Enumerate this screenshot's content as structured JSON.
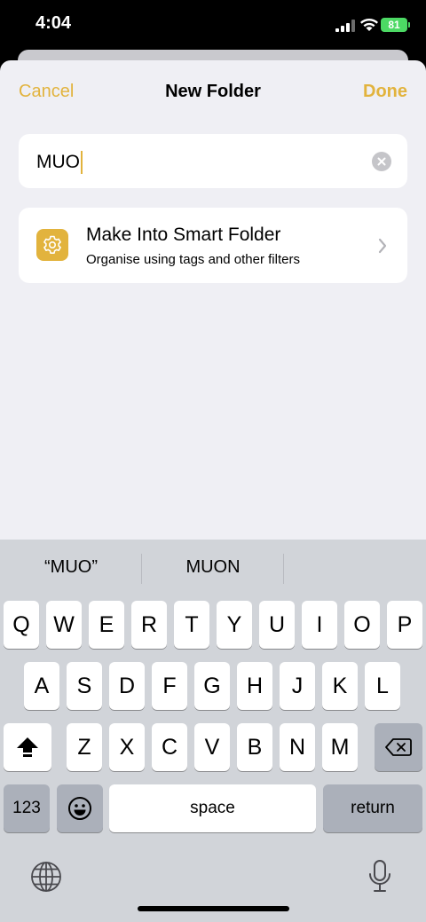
{
  "status_bar": {
    "time": "4:04",
    "battery": "81"
  },
  "nav": {
    "cancel": "Cancel",
    "title": "New Folder",
    "done": "Done"
  },
  "name_field": {
    "value": "MUO"
  },
  "smart_folder": {
    "title": "Make Into Smart Folder",
    "subtitle": "Organise using tags and other filters"
  },
  "keyboard": {
    "suggestions": [
      "“MUO”",
      "MUON",
      ""
    ],
    "row1": [
      "Q",
      "W",
      "E",
      "R",
      "T",
      "Y",
      "U",
      "I",
      "O",
      "P"
    ],
    "row2": [
      "A",
      "S",
      "D",
      "F",
      "G",
      "H",
      "J",
      "K",
      "L"
    ],
    "row3": [
      "Z",
      "X",
      "C",
      "V",
      "B",
      "N",
      "M"
    ],
    "numbers_key": "123",
    "space_key": "space",
    "return_key": "return"
  },
  "colors": {
    "accent": "#e2b33d",
    "background": "#efeff4",
    "keyboard": "#d1d4d9"
  },
  "icons": [
    "signal-icon",
    "wifi-icon",
    "battery-icon",
    "clear-icon",
    "gear-icon",
    "chevron-right-icon",
    "shift-icon",
    "delete-icon",
    "emoji-icon",
    "globe-icon",
    "microphone-icon"
  ]
}
